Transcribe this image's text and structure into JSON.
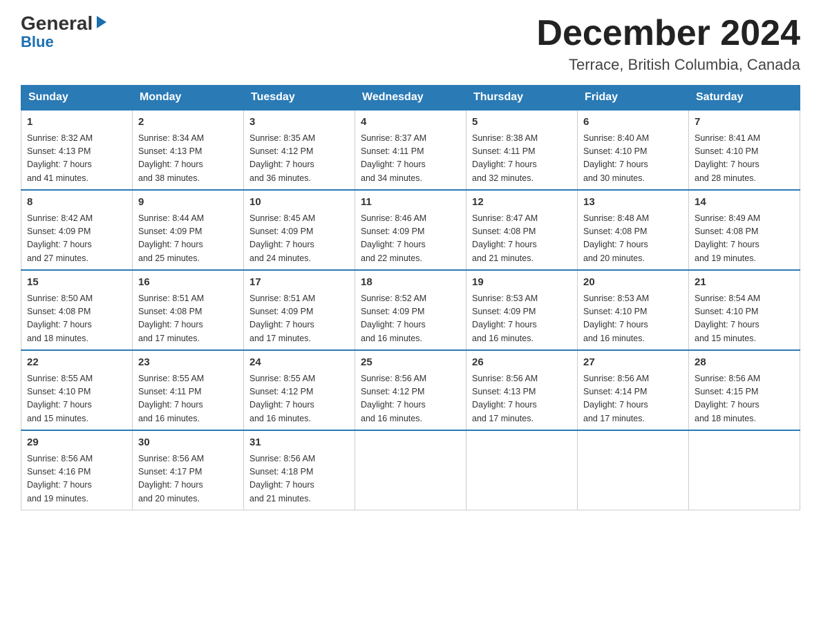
{
  "header": {
    "logo_general": "General",
    "logo_blue": "Blue",
    "calendar_title": "December 2024",
    "calendar_subtitle": "Terrace, British Columbia, Canada"
  },
  "days_of_week": [
    "Sunday",
    "Monday",
    "Tuesday",
    "Wednesday",
    "Thursday",
    "Friday",
    "Saturday"
  ],
  "weeks": [
    [
      {
        "day": "1",
        "sunrise": "Sunrise: 8:32 AM",
        "sunset": "Sunset: 4:13 PM",
        "daylight": "Daylight: 7 hours",
        "minutes": "and 41 minutes."
      },
      {
        "day": "2",
        "sunrise": "Sunrise: 8:34 AM",
        "sunset": "Sunset: 4:13 PM",
        "daylight": "Daylight: 7 hours",
        "minutes": "and 38 minutes."
      },
      {
        "day": "3",
        "sunrise": "Sunrise: 8:35 AM",
        "sunset": "Sunset: 4:12 PM",
        "daylight": "Daylight: 7 hours",
        "minutes": "and 36 minutes."
      },
      {
        "day": "4",
        "sunrise": "Sunrise: 8:37 AM",
        "sunset": "Sunset: 4:11 PM",
        "daylight": "Daylight: 7 hours",
        "minutes": "and 34 minutes."
      },
      {
        "day": "5",
        "sunrise": "Sunrise: 8:38 AM",
        "sunset": "Sunset: 4:11 PM",
        "daylight": "Daylight: 7 hours",
        "minutes": "and 32 minutes."
      },
      {
        "day": "6",
        "sunrise": "Sunrise: 8:40 AM",
        "sunset": "Sunset: 4:10 PM",
        "daylight": "Daylight: 7 hours",
        "minutes": "and 30 minutes."
      },
      {
        "day": "7",
        "sunrise": "Sunrise: 8:41 AM",
        "sunset": "Sunset: 4:10 PM",
        "daylight": "Daylight: 7 hours",
        "minutes": "and 28 minutes."
      }
    ],
    [
      {
        "day": "8",
        "sunrise": "Sunrise: 8:42 AM",
        "sunset": "Sunset: 4:09 PM",
        "daylight": "Daylight: 7 hours",
        "minutes": "and 27 minutes."
      },
      {
        "day": "9",
        "sunrise": "Sunrise: 8:44 AM",
        "sunset": "Sunset: 4:09 PM",
        "daylight": "Daylight: 7 hours",
        "minutes": "and 25 minutes."
      },
      {
        "day": "10",
        "sunrise": "Sunrise: 8:45 AM",
        "sunset": "Sunset: 4:09 PM",
        "daylight": "Daylight: 7 hours",
        "minutes": "and 24 minutes."
      },
      {
        "day": "11",
        "sunrise": "Sunrise: 8:46 AM",
        "sunset": "Sunset: 4:09 PM",
        "daylight": "Daylight: 7 hours",
        "minutes": "and 22 minutes."
      },
      {
        "day": "12",
        "sunrise": "Sunrise: 8:47 AM",
        "sunset": "Sunset: 4:08 PM",
        "daylight": "Daylight: 7 hours",
        "minutes": "and 21 minutes."
      },
      {
        "day": "13",
        "sunrise": "Sunrise: 8:48 AM",
        "sunset": "Sunset: 4:08 PM",
        "daylight": "Daylight: 7 hours",
        "minutes": "and 20 minutes."
      },
      {
        "day": "14",
        "sunrise": "Sunrise: 8:49 AM",
        "sunset": "Sunset: 4:08 PM",
        "daylight": "Daylight: 7 hours",
        "minutes": "and 19 minutes."
      }
    ],
    [
      {
        "day": "15",
        "sunrise": "Sunrise: 8:50 AM",
        "sunset": "Sunset: 4:08 PM",
        "daylight": "Daylight: 7 hours",
        "minutes": "and 18 minutes."
      },
      {
        "day": "16",
        "sunrise": "Sunrise: 8:51 AM",
        "sunset": "Sunset: 4:08 PM",
        "daylight": "Daylight: 7 hours",
        "minutes": "and 17 minutes."
      },
      {
        "day": "17",
        "sunrise": "Sunrise: 8:51 AM",
        "sunset": "Sunset: 4:09 PM",
        "daylight": "Daylight: 7 hours",
        "minutes": "and 17 minutes."
      },
      {
        "day": "18",
        "sunrise": "Sunrise: 8:52 AM",
        "sunset": "Sunset: 4:09 PM",
        "daylight": "Daylight: 7 hours",
        "minutes": "and 16 minutes."
      },
      {
        "day": "19",
        "sunrise": "Sunrise: 8:53 AM",
        "sunset": "Sunset: 4:09 PM",
        "daylight": "Daylight: 7 hours",
        "minutes": "and 16 minutes."
      },
      {
        "day": "20",
        "sunrise": "Sunrise: 8:53 AM",
        "sunset": "Sunset: 4:10 PM",
        "daylight": "Daylight: 7 hours",
        "minutes": "and 16 minutes."
      },
      {
        "day": "21",
        "sunrise": "Sunrise: 8:54 AM",
        "sunset": "Sunset: 4:10 PM",
        "daylight": "Daylight: 7 hours",
        "minutes": "and 15 minutes."
      }
    ],
    [
      {
        "day": "22",
        "sunrise": "Sunrise: 8:55 AM",
        "sunset": "Sunset: 4:10 PM",
        "daylight": "Daylight: 7 hours",
        "minutes": "and 15 minutes."
      },
      {
        "day": "23",
        "sunrise": "Sunrise: 8:55 AM",
        "sunset": "Sunset: 4:11 PM",
        "daylight": "Daylight: 7 hours",
        "minutes": "and 16 minutes."
      },
      {
        "day": "24",
        "sunrise": "Sunrise: 8:55 AM",
        "sunset": "Sunset: 4:12 PM",
        "daylight": "Daylight: 7 hours",
        "minutes": "and 16 minutes."
      },
      {
        "day": "25",
        "sunrise": "Sunrise: 8:56 AM",
        "sunset": "Sunset: 4:12 PM",
        "daylight": "Daylight: 7 hours",
        "minutes": "and 16 minutes."
      },
      {
        "day": "26",
        "sunrise": "Sunrise: 8:56 AM",
        "sunset": "Sunset: 4:13 PM",
        "daylight": "Daylight: 7 hours",
        "minutes": "and 17 minutes."
      },
      {
        "day": "27",
        "sunrise": "Sunrise: 8:56 AM",
        "sunset": "Sunset: 4:14 PM",
        "daylight": "Daylight: 7 hours",
        "minutes": "and 17 minutes."
      },
      {
        "day": "28",
        "sunrise": "Sunrise: 8:56 AM",
        "sunset": "Sunset: 4:15 PM",
        "daylight": "Daylight: 7 hours",
        "minutes": "and 18 minutes."
      }
    ],
    [
      {
        "day": "29",
        "sunrise": "Sunrise: 8:56 AM",
        "sunset": "Sunset: 4:16 PM",
        "daylight": "Daylight: 7 hours",
        "minutes": "and 19 minutes."
      },
      {
        "day": "30",
        "sunrise": "Sunrise: 8:56 AM",
        "sunset": "Sunset: 4:17 PM",
        "daylight": "Daylight: 7 hours",
        "minutes": "and 20 minutes."
      },
      {
        "day": "31",
        "sunrise": "Sunrise: 8:56 AM",
        "sunset": "Sunset: 4:18 PM",
        "daylight": "Daylight: 7 hours",
        "minutes": "and 21 minutes."
      },
      null,
      null,
      null,
      null
    ]
  ]
}
